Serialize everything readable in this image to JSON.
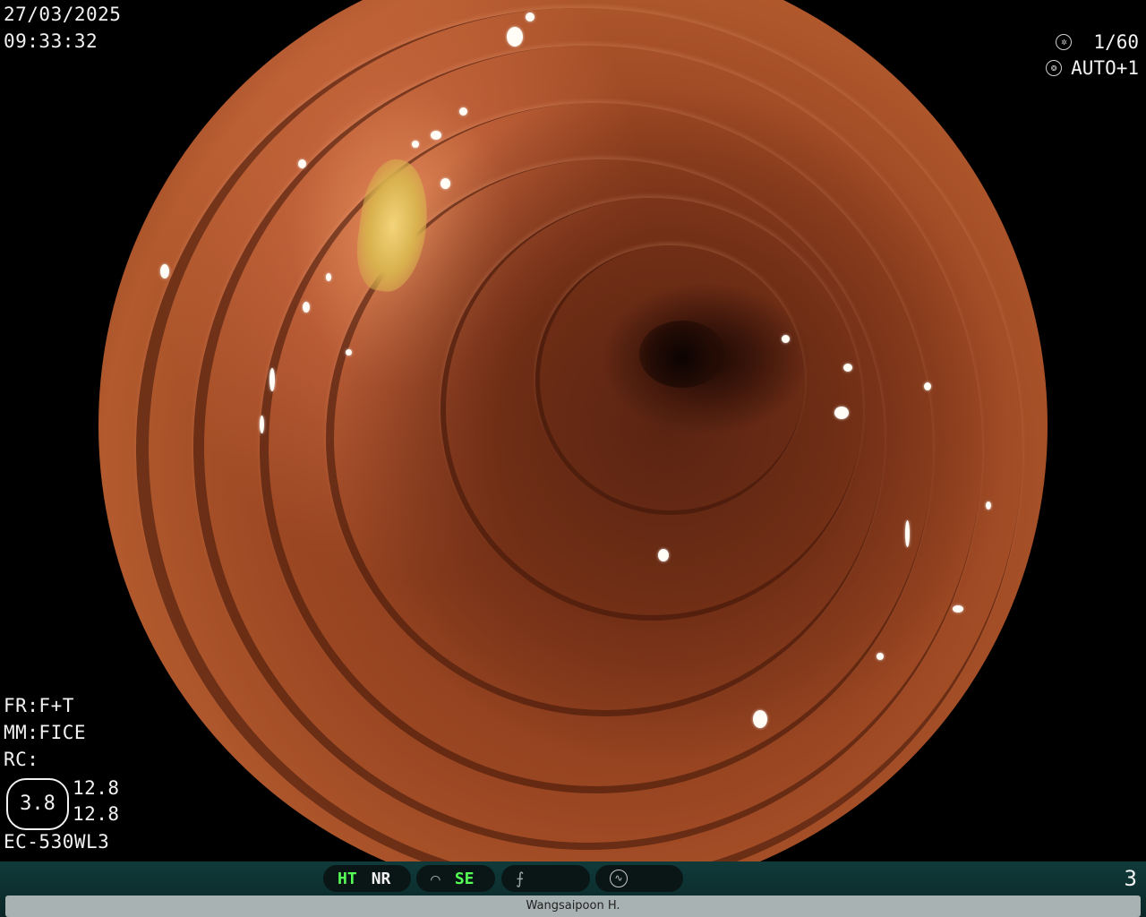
{
  "timestamp": {
    "date": "27/03/2025",
    "time": "09:33:32"
  },
  "camera": {
    "shutter": "1/60",
    "iris": "AUTO+1",
    "shutter_icon": "aperture-icon",
    "iris_icon": "iris-icon"
  },
  "settings": {
    "fr": "FR:F+T",
    "mm": "MM:FICE",
    "rc": "RC:",
    "zoom_value": "3.8",
    "value_upper": "12.8",
    "value_lower": "12.8",
    "scope_model": "EC-530WL3"
  },
  "indicators": {
    "ht": "HT",
    "nr": "NR",
    "se": "SE",
    "se_icon": "tone-curve-icon",
    "sharpness_icon": "sharpness-icon",
    "mode_icon": "waveform-icon",
    "active_color": "#56ff56"
  },
  "image_number": "3",
  "operator": "Wangsaipoon H."
}
